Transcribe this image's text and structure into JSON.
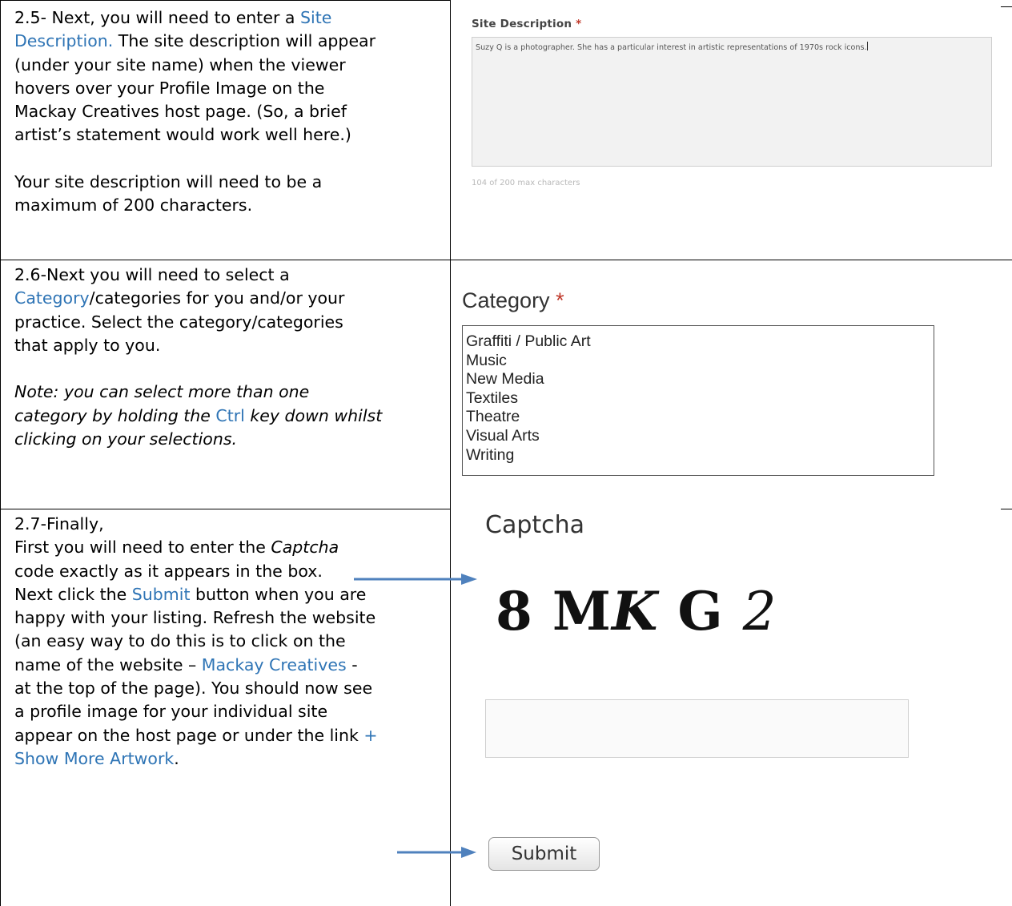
{
  "step25": {
    "line1_a": "2.5- Next, you will need to enter a ",
    "line1_kw": "Site",
    "line2_kw": "Description.",
    "line2_b": " The site description will appear",
    "line3": "(under your site name) when the viewer",
    "line4": "hovers over your Profile Image on the",
    "line5": "Mackay Creatives host page. (So, a brief",
    "line6": "artist’s statement would work well here.)",
    "line7": "Your site description will need to be a",
    "line8": "maximum of 200 characters."
  },
  "step26": {
    "line1": "2.6-Next you will need to select a",
    "line2_kw": "Category",
    "line2_b": "/categories for you and/or your",
    "line3": "practice. Select the category/categories",
    "line4": "that apply to you.",
    "note1": "Note: you can select more than one",
    "note2_a": "category by holding the ",
    "note2_kw": "Ctrl",
    "note2_b": " key down whilst",
    "note3": "clicking on your selections."
  },
  "step27": {
    "line1": "2.7-Finally,",
    "line2_a": "First you will need to enter the ",
    "line2_it": "Captcha",
    "line3": "code exactly as it appears in the box.",
    "line4_a": "Next click the ",
    "line4_kw": "Submit",
    "line4_b": " button when you are",
    "line5": "happy with your listing. Refresh the website",
    "line6": "(an easy way to do this is to click on the",
    "line7_a": "name of the website – ",
    "line7_kw": "Mackay Creatives",
    "line7_b": " -",
    "line8": "at the top of the page). You should now see",
    "line9": "a profile image for your individual site",
    "line10_a": "appear on the host page or under the link ",
    "line10_kw": "+",
    "line11_kw": "Show More Artwork",
    "line11_b": "."
  },
  "site_description": {
    "label": "Site Description",
    "required_mark": "*",
    "value": "Suzy Q is a photographer. She has a particular interest in artistic representations of 1970s rock icons.",
    "counter": "104 of 200 max characters"
  },
  "category": {
    "label": "Category",
    "required_mark": "*",
    "options": [
      "Graffiti / Public Art",
      "Music",
      "New Media",
      "Textiles",
      "Theatre",
      "Visual Arts",
      "Writing"
    ]
  },
  "captcha": {
    "label": "Captcha",
    "code_1": "8 M",
    "code_2": "K",
    "code_3": " G ",
    "code_4": "2"
  },
  "submit": {
    "label": "Submit"
  },
  "colors": {
    "keyword": "#2e74b5",
    "arrow": "#4f81bd",
    "required": "#c0392b"
  }
}
